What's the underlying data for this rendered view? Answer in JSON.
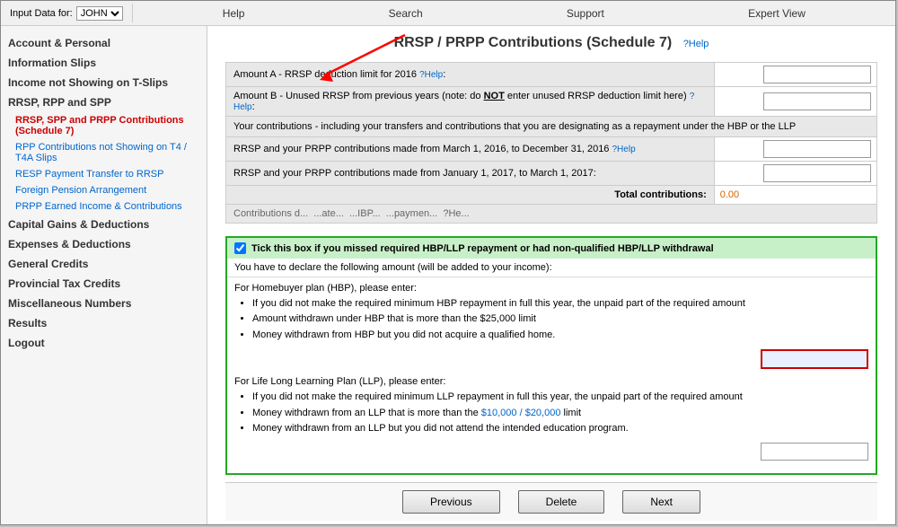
{
  "topNav": {
    "inputDataFor": "Input Data for:",
    "userSelect": "JOHN",
    "navItems": [
      "Help",
      "Search",
      "Support",
      "Expert View"
    ]
  },
  "sidebar": {
    "sections": [
      {
        "id": "account",
        "label": "Account & Personal",
        "type": "section"
      },
      {
        "id": "info-slips",
        "label": "Information Slips",
        "type": "section"
      },
      {
        "id": "income-not",
        "label": "Income not Showing on T-Slips",
        "type": "section"
      },
      {
        "id": "rrsp-rpp",
        "label": "RRSP, RPP and SPP",
        "type": "section"
      },
      {
        "id": "rrsp-spp-prpp",
        "label": "RRSP, SPP and PRPP Contributions (Schedule 7)",
        "type": "item",
        "active": true
      },
      {
        "id": "rpp-not-showing",
        "label": "RPP Contributions not Showing on T4 / T4A Slips",
        "type": "item"
      },
      {
        "id": "resp-transfer",
        "label": "RESP Payment Transfer to RRSP",
        "type": "item"
      },
      {
        "id": "foreign-pension",
        "label": "Foreign Pension Arrangement",
        "type": "item"
      },
      {
        "id": "prpp-earned",
        "label": "PRPP Earned Income & Contributions",
        "type": "item"
      },
      {
        "id": "capital-gains",
        "label": "Capital Gains & Deductions",
        "type": "section"
      },
      {
        "id": "expenses",
        "label": "Expenses & Deductions",
        "type": "section"
      },
      {
        "id": "general-credits",
        "label": "General Credits",
        "type": "section"
      },
      {
        "id": "provincial-tax",
        "label": "Provincial Tax Credits",
        "type": "section"
      },
      {
        "id": "misc",
        "label": "Miscellaneous Numbers",
        "type": "section"
      },
      {
        "id": "results",
        "label": "Results",
        "type": "section"
      },
      {
        "id": "logout",
        "label": "Logout",
        "type": "section"
      }
    ]
  },
  "content": {
    "pageTitle": "RRSP / PRPP Contributions (Schedule 7)",
    "helpLink": "?Help",
    "rows": [
      {
        "id": "amount-a",
        "label": "Amount A - RRSP deduction limit for 2016",
        "helpLink": "?Help",
        "value": ""
      },
      {
        "id": "amount-b",
        "label": "Amount B - Unused RRSP from previous years (note: do NOT enter unused RRSP deduction limit here)",
        "helpLink": "?Help",
        "hasNot": true,
        "value": ""
      },
      {
        "id": "contributions-label",
        "label": "Your contributions - including your transfers and contributions that you are designating as a repayment under the HBP or the LLP",
        "value": null,
        "header": true
      },
      {
        "id": "rrsp-prpp-2016",
        "label": "RRSP and your PRPP contributions made from March 1, 2016, to December 31, 2016",
        "helpLink": "?Help",
        "value": ""
      },
      {
        "id": "rrsp-prpp-2017",
        "label": "RRSP and your PRPP contributions made from January 1, 2017, to March 1, 2017:",
        "value": ""
      }
    ],
    "totalLabel": "Total contributions:",
    "totalValue": "0.00",
    "partialRow": "Contributions d... ...ate... ...IBP... ...paymen... ?He...",
    "hbpSection": {
      "checkboxLabel": "Tick this box if you missed required HBP/LLP repayment or had non-qualified HBP/LLP withdrawal",
      "checked": true,
      "declareText": "You have to declare the following amount (will be added to your income):",
      "hbpTitle": "For Homebuyer plan (HBP), please enter:",
      "hbpBullets": [
        "If you did not make the required minimum HBP repayment in full this year, the unpaid part of the required amount",
        "Amount withdrawn under HBP that is more than the $25,000 limit",
        "Money withdrawn from HBP but you did not acquire a qualified home."
      ],
      "hbpValue": "",
      "llpTitle": "For Life Long Learning Plan (LLP), please enter:",
      "llpBullets": [
        "If you did not make the required minimum LLP repayment in full this year, the unpaid part of the required amount",
        "Money withdrawn from an LLP that is more than the $10,000 / $20,000 limit",
        "Money withdrawn from an LLP but you did not attend the intended education program."
      ],
      "llpMoneyLink": "$10,000 / $20,000",
      "llpValue": ""
    },
    "buttons": {
      "previous": "Previous",
      "delete": "Delete",
      "next": "Next"
    }
  }
}
